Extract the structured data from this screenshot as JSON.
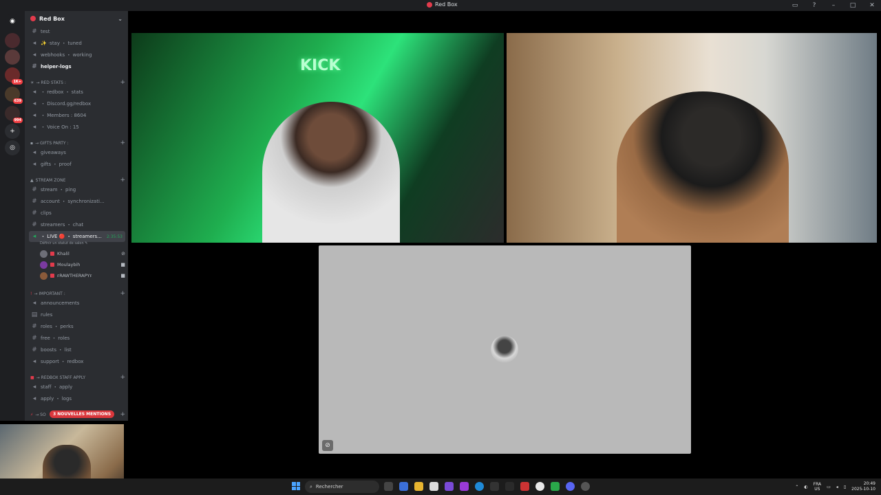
{
  "window": {
    "title": "Red Box"
  },
  "server": {
    "name": "Red Box"
  },
  "server_badges": [
    "1K+",
    "639",
    "994"
  ],
  "channels": {
    "top": [
      {
        "name": "test",
        "type": "text"
      },
      {
        "name": "✨ ·stay ・ tuned",
        "type": "voice"
      },
      {
        "name": "webhooks ・ working",
        "type": "voice"
      },
      {
        "name": "helper-logs",
        "type": "text",
        "bold": true
      }
    ],
    "red_stats": {
      "label": "→ Red Stats :",
      "items": [
        {
          "name": "・ redbox ・ stats"
        },
        {
          "name": "・ Discord.gg/redbox"
        },
        {
          "name": "・ Members : 8604"
        },
        {
          "name": "・ Voice On : 15"
        }
      ]
    },
    "gifts": {
      "label": "→ GIFTS PARTY :",
      "items": [
        {
          "name": "giveaways"
        },
        {
          "name": "gifts ・ proof"
        }
      ]
    },
    "stream": {
      "label": "STREAM ZONE",
      "items": [
        {
          "name": "stream ・ ping"
        },
        {
          "name": "account ・ synchronizati..."
        },
        {
          "name": "clips"
        },
        {
          "name": "streamers ・ chat"
        }
      ],
      "live": {
        "name": "・ LIVE 🔴 ・ streamers...",
        "timer": "2:35:53",
        "status": "Définir un statut de salon ✎"
      },
      "voice_users": [
        "Khalil",
        "Moulaybih",
        "ꜰRAWTHERAPYꜰ"
      ]
    },
    "important": {
      "label": "→ IMPORTANT :",
      "items": [
        {
          "name": "announcements"
        },
        {
          "name": "rules"
        },
        {
          "name": "roles ・ perks"
        },
        {
          "name": "free ・ roles"
        },
        {
          "name": "boosts ・ list"
        },
        {
          "name": "support ・ redbox"
        }
      ]
    },
    "staff": {
      "label": "→ REDBOX STAFF APPLY",
      "items": [
        {
          "name": "staff ・ apply"
        },
        {
          "name": "apply ・ logs"
        }
      ]
    },
    "so_cut": "→ SO",
    "mentions_pill": "3 NOUVELLES MENTIONS"
  },
  "video": {
    "tile1_sign": "KICK"
  },
  "taskbar": {
    "search": "Rechercher",
    "lang_1": "FRA",
    "lang_2": "US",
    "time": "20:49",
    "date": "2025-10-10"
  },
  "colors": {
    "brand": "#e23b4c",
    "live_green": "#23a55a",
    "mention": "#da373c"
  }
}
